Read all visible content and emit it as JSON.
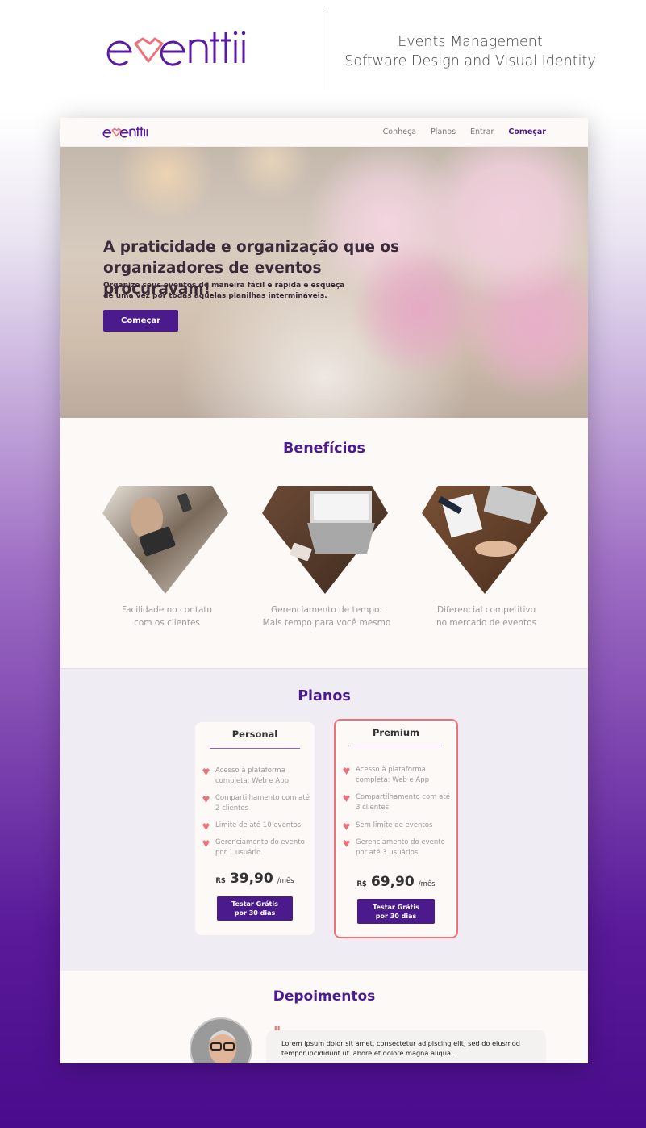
{
  "brand": {
    "name": "eventti",
    "accent": "#4b1a8c",
    "heart_color": "#f0707a"
  },
  "tagline": {
    "line1": "Events Management",
    "line2": "Software Design and Visual Identity"
  },
  "nav": {
    "items": [
      {
        "label": "Conheça",
        "active": false
      },
      {
        "label": "Planos",
        "active": false
      },
      {
        "label": "Entrar",
        "active": false
      },
      {
        "label": "Começar",
        "active": true
      }
    ]
  },
  "hero": {
    "title": "A praticidade e organização que os organizadores de eventos procuravam!",
    "subtitle": "Organize seus eventos de maneira fácil e rápida e esqueça de uma vez por todas aquelas planilhas intermináveis.",
    "cta": "Começar"
  },
  "benefits": {
    "title": "Benefícios",
    "items": [
      {
        "line1": "Facilidade no contato",
        "line2": "com os clientes"
      },
      {
        "line1": "Gerenciamento de tempo:",
        "line2": "Mais tempo para você mesmo"
      },
      {
        "line1": "Diferencial competitivo",
        "line2": "no mercado de eventos"
      }
    ]
  },
  "plans": {
    "title": "Planos",
    "personal": {
      "name": "Personal",
      "features": [
        "Acesso à plataforma completa: Web e App",
        "Compartilhamento com até 2 clientes",
        "Limite de até 10 eventos",
        "Gerenciamento do evento por 1 usuário"
      ],
      "currency": "R$",
      "price": "39,90",
      "period": "/mês",
      "cta_line1": "Testar Grátis",
      "cta_line2": "por 30 dias"
    },
    "premium": {
      "name": "Premium",
      "features": [
        "Acesso à plataforma completa: Web e App",
        "Compartilhamento com até 3 clientes",
        "Sem limite de eventos",
        "Gerenciamento do evento por até 3 usuários"
      ],
      "currency": "R$",
      "price": "69,90",
      "period": "/mês",
      "cta_line1": "Testar Grátis",
      "cta_line2": "por 30 dias"
    }
  },
  "testimonials": {
    "title": "Depoimentos",
    "quote_mark": "\"",
    "quote": "Lorem ipsum dolor sit amet, consectetur adipiscing elit, sed do eiusmod tempor incididunt ut labore et dolore magna aliqua."
  }
}
